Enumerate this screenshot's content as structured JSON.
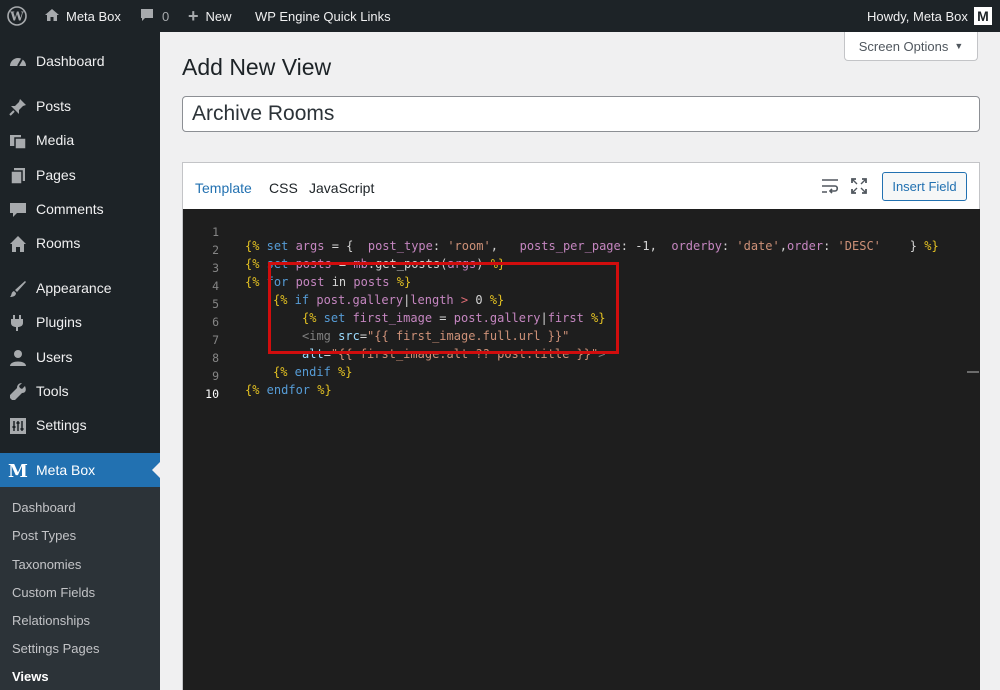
{
  "adminbar": {
    "site_name": "Meta Box",
    "comments_count": "0",
    "new_label": "New",
    "quick_links_label": "WP Engine Quick Links",
    "howdy": "Howdy, Meta Box",
    "avatar_letter": "M"
  },
  "sidebar": {
    "items": [
      {
        "label": "Dashboard",
        "icon": "dashboard-icon"
      },
      {
        "label": "Posts",
        "icon": "pin-icon"
      },
      {
        "label": "Media",
        "icon": "media-icon"
      },
      {
        "label": "Pages",
        "icon": "page-icon"
      },
      {
        "label": "Comments",
        "icon": "comment-icon"
      },
      {
        "label": "Rooms",
        "icon": "home-icon"
      },
      {
        "label": "Appearance",
        "icon": "brush-icon"
      },
      {
        "label": "Plugins",
        "icon": "plugin-icon"
      },
      {
        "label": "Users",
        "icon": "user-icon"
      },
      {
        "label": "Tools",
        "icon": "wrench-icon"
      },
      {
        "label": "Settings",
        "icon": "settings-icon"
      },
      {
        "label": "Meta Box",
        "icon": "meta-box-logo-icon"
      }
    ],
    "submenu": [
      "Dashboard",
      "Post Types",
      "Taxonomies",
      "Custom Fields",
      "Relationships",
      "Settings Pages",
      "Views"
    ]
  },
  "screen_options_label": "Screen Options",
  "page_title": "Add New View",
  "view_title_value": "Archive Rooms",
  "editor": {
    "tabs": [
      "Template",
      "CSS",
      "JavaScript"
    ],
    "active_tab": "Template",
    "insert_field_label": "Insert Field",
    "line_numbers": [
      "1",
      "2",
      "3",
      "4",
      "5",
      "6",
      "7",
      "8",
      "9",
      "10"
    ],
    "code": {
      "l1": {
        "a": "{%",
        "b": " set ",
        "c": "args",
        "d": " = {  ",
        "e": "post_type",
        "f": ": ",
        "g": "'room'",
        "h": ",   ",
        "i": "posts_per_page",
        "j": ": ",
        "k": "-1",
        "l": ",  ",
        "m": "orderby",
        "n": ": ",
        "o": "'date'",
        "p": ",",
        "q": "order",
        "r": ": ",
        "s": "'DESC'",
        "t": "    } ",
        "u": "%}"
      },
      "l2": {
        "a": "{%",
        "b": " set ",
        "c": "posts",
        "d": " = ",
        "e": "mb",
        "f": ".get_posts(",
        "g": "args",
        "h": ") ",
        "i": "%}"
      },
      "l3": {
        "a": "{%",
        "b": " for ",
        "c": "post",
        "d": " in ",
        "e": "posts",
        "f": " %}"
      },
      "l4": {
        "a": "{%",
        "b": " if ",
        "c": "post.gallery",
        "d": "|",
        "e": "length",
        "f": " > ",
        "g": "0",
        "h": " %}"
      },
      "l5": {
        "a": "{%",
        "b": " set ",
        "c": "first_image",
        "d": " = ",
        "e": "post.gallery",
        "f": "|",
        "g": "first",
        "h": " %}"
      },
      "l6": {
        "a": "<img",
        "b": " src",
        "c": "=",
        "d": "\"{{ first_image.full.url }}\""
      },
      "l7": {
        "a": "alt",
        "b": "=",
        "c": "\"{{ first_image.alt ?? post.title }}\"",
        "d": ">"
      },
      "l8": {
        "a": "{%",
        "b": " endif ",
        "c": "%}"
      },
      "l9": {
        "a": "{%",
        "b": " endfor ",
        "c": "%}"
      }
    }
  },
  "colors": {
    "admin_bg": "#1d2327",
    "accent": "#2271b1",
    "editor_bg": "#1e1e1e",
    "highlight": "#d10d0d"
  }
}
